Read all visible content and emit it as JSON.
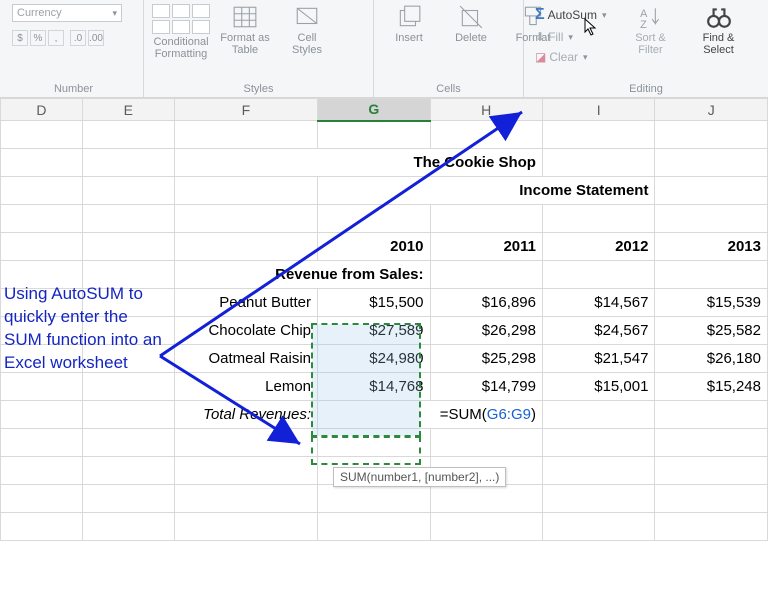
{
  "ribbon": {
    "number": {
      "format": "Currency",
      "group_label": "Number"
    },
    "styles": {
      "cond": "Conditional\nFormatting",
      "cond_drop": "▾",
      "table": "Format as\nTable",
      "cell": "Cell\nStyles",
      "group_label": "Styles"
    },
    "cells": {
      "insert": "Insert",
      "delete": "Delete",
      "format": "Format",
      "group_label": "Cells"
    },
    "editing": {
      "autosum": "AutoSum",
      "fill": "Fill",
      "clear": "Clear",
      "sort": "Sort &\nFilter",
      "find": "Find &\nSelect",
      "group_label": "Editing"
    }
  },
  "cols": [
    "D",
    "E",
    "F",
    "G",
    "H",
    "I",
    "J"
  ],
  "active_col": "G",
  "annotation": "Using AutoSUM to quickly enter the SUM function into an Excel worksheet",
  "title": "The Cookie Shop",
  "subtitle": "Income Statement",
  "years": [
    "2010",
    "2011",
    "2012",
    "2013"
  ],
  "section": "Revenue from Sales:",
  "rows": [
    {
      "label": "Peanut Butter",
      "v": [
        "$15,500",
        "$16,896",
        "$14,567",
        "$15,539"
      ]
    },
    {
      "label": "Chocolate Chip",
      "v": [
        "$27,589",
        "$26,298",
        "$24,567",
        "$25,582"
      ]
    },
    {
      "label": "Oatmeal  Raisin",
      "v": [
        "$24,980",
        "$25,298",
        "$21,547",
        "$26,180"
      ]
    },
    {
      "label": "Lemon",
      "v": [
        "$14,768",
        "$14,799",
        "$15,001",
        "$15,248"
      ]
    }
  ],
  "total_label": "Total Revenues:",
  "formula_prefix": "=SUM(",
  "formula_ref": "G6:G9",
  "formula_suffix": ")",
  "tooltip": "SUM(number1, [number2], ...)"
}
